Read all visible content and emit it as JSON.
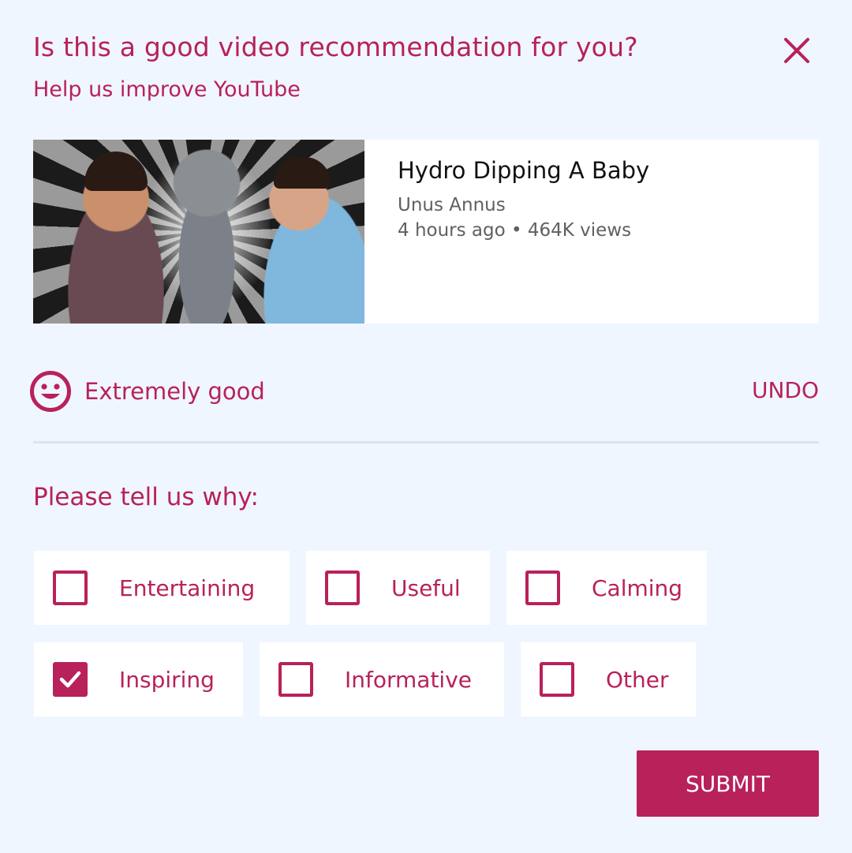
{
  "dialog": {
    "title": "Is this a good video recommendation for you?",
    "subtitle": "Help us improve YouTube",
    "close_icon": "close-icon"
  },
  "video": {
    "title": "Hydro Dipping A Baby",
    "channel": "Unus Annus",
    "meta": "4 hours ago • 464K views"
  },
  "rating": {
    "icon": "smiley-icon",
    "label": "Extremely good",
    "undo_label": "UNDO"
  },
  "reasons": {
    "prompt": "Please tell us why:",
    "options": [
      {
        "label": "Entertaining",
        "checked": false
      },
      {
        "label": "Useful",
        "checked": false
      },
      {
        "label": "Calming",
        "checked": false
      },
      {
        "label": "Inspiring",
        "checked": true
      },
      {
        "label": "Informative",
        "checked": false
      },
      {
        "label": "Other",
        "checked": false
      }
    ]
  },
  "submit_label": "SUBMIT",
  "colors": {
    "accent": "#b8215a",
    "background": "#f0f6ff",
    "card": "#ffffff",
    "divider": "#dde3ec"
  }
}
